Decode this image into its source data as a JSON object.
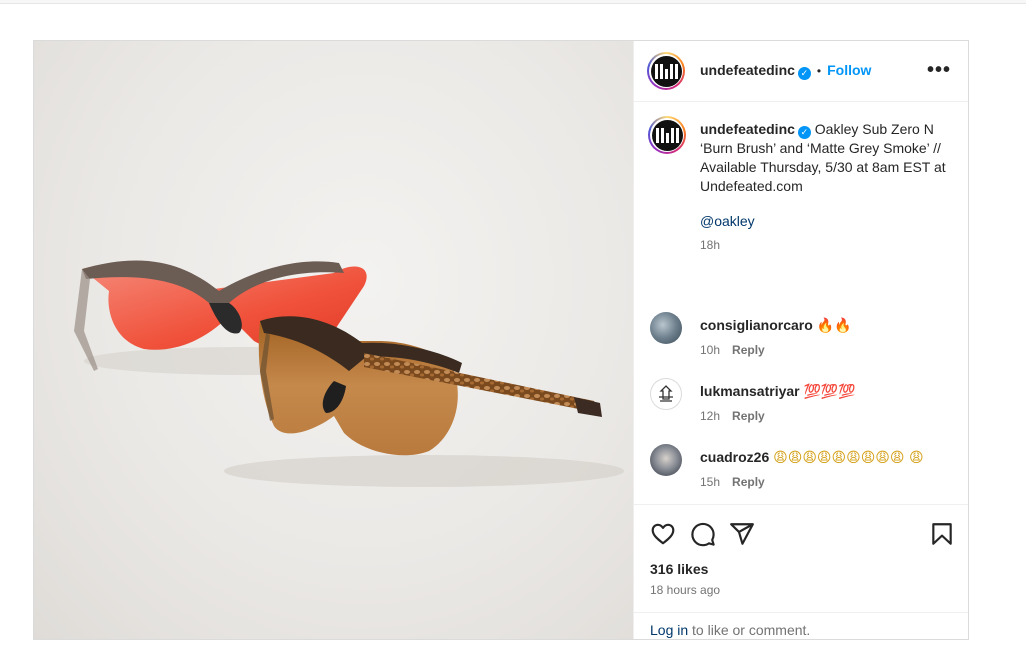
{
  "post": {
    "username": "undefeatedinc",
    "follow_label": "Follow",
    "separator": "•",
    "more_label": "•••",
    "caption": {
      "username": "undefeatedinc",
      "text": "Oakley Sub Zero N ‘Burn Brush’ and ‘Matte Grey Smoke’ // Available Thursday, 5/30 at 8am EST at Undefeated.com",
      "mention": "@oakley",
      "time": "18h"
    },
    "comments": [
      {
        "username": "consiglianorcaro",
        "text": "🔥🔥",
        "time": "10h",
        "reply": "Reply"
      },
      {
        "username": "lukmansatriyar",
        "text": "💯💯💯",
        "time": "12h",
        "reply": "Reply"
      },
      {
        "username": "cuadroz26",
        "text": "😩😩😩😩😩😩😩😩😩 😩",
        "time": "15h",
        "reply": "Reply"
      }
    ],
    "likes": "316 likes",
    "time_ago": "18 hours ago",
    "login": {
      "link": "Log in",
      "rest": " to like or comment."
    }
  },
  "icons": {
    "like": "heart-icon",
    "comment": "comment-icon",
    "share": "share-icon",
    "save": "bookmark-icon",
    "verified": "verified-badge-icon"
  },
  "colors": {
    "accent": "#0095f6",
    "link": "#00376b",
    "muted": "#737373"
  }
}
